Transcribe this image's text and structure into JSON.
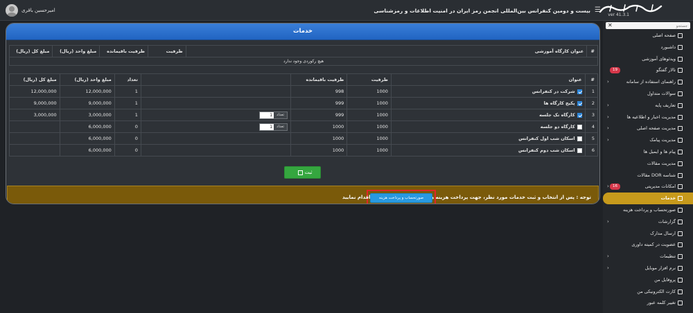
{
  "header": {
    "logo_alt": "تریبون",
    "version": "ver 41.3.1",
    "title": "بیست و دومین کنفرانس بین‌المللی انجمن رمز ایران در امنیت اطلاعات و رمزشناسی",
    "user_name": "امیرحسین باقری"
  },
  "sidebar": {
    "search_placeholder": "جستجو",
    "items": [
      {
        "label": "صفحه اصلی",
        "icon": "home-icon",
        "chevron": false
      },
      {
        "label": "داشبورد",
        "icon": "dashboard-icon",
        "chevron": false
      },
      {
        "label": "ویدئوهای آموزشی",
        "icon": "video-icon",
        "chevron": false
      },
      {
        "label": "تالار گفتگو",
        "icon": "chat-icon",
        "chevron": false,
        "badge": "19"
      },
      {
        "label": "راهنمای استفاده از سامانه",
        "icon": "info-icon",
        "chevron": true
      },
      {
        "label": "سوالات متداول",
        "icon": "faq-icon",
        "chevron": false
      },
      {
        "label": "تعاریف پایه",
        "icon": "list-icon",
        "chevron": true
      },
      {
        "label": "مدیریت اخبار و اطلاعیه ها",
        "icon": "news-icon",
        "chevron": true
      },
      {
        "label": "مدیریت صفحه اصلی",
        "icon": "home-settings-icon",
        "chevron": true
      },
      {
        "label": "مدیریت پیامک",
        "icon": "sms-icon",
        "chevron": true
      },
      {
        "label": "پیام ها و ایمیل ها",
        "icon": "mail-icon",
        "chevron": false
      },
      {
        "label": "مدیریت مقالات",
        "icon": "articles-icon",
        "chevron": false
      },
      {
        "label": "شناسه DOR مقالات",
        "icon": "dor-icon",
        "chevron": false
      },
      {
        "label": "امکانات مدیریتی",
        "icon": "tools-icon",
        "chevron": true,
        "badge": "16"
      },
      {
        "label": "خدمات",
        "icon": "services-icon",
        "chevron": false,
        "active": true
      },
      {
        "label": "صورتحساب و پرداخت هزینه",
        "icon": "invoice-icon",
        "chevron": false
      },
      {
        "label": "گزارشات",
        "icon": "reports-icon",
        "chevron": true
      },
      {
        "label": "ارسال مدارک",
        "icon": "upload-icon",
        "chevron": false
      },
      {
        "label": "عضویت در کمیته داوری",
        "icon": "committee-icon",
        "chevron": false
      },
      {
        "label": "تنظیمات",
        "icon": "settings-icon",
        "chevron": true
      },
      {
        "label": "نرم افزار موبایل",
        "icon": "mobile-icon",
        "chevron": true
      },
      {
        "label": "پروفایل من",
        "icon": "profile-icon",
        "chevron": false
      },
      {
        "label": "کارت الکترونیکی من",
        "icon": "card-icon",
        "chevron": false
      },
      {
        "label": "تغییر کلمه عبور",
        "icon": "key-icon",
        "chevron": false
      }
    ]
  },
  "main": {
    "title": "خدمات",
    "workshop_table": {
      "headers": [
        "#",
        "عنوان کارگاه آموزشی",
        "ظرفیت",
        "ظرفیت باقیمانده",
        "مبلغ واحد (ریال)",
        "مبلغ کل (ریال)"
      ],
      "empty_text": "هیچ رکوردی وجود ندارد"
    },
    "services_table": {
      "headers": [
        "#",
        "عنوان",
        "ظرفیت",
        "ظرفیت باقیمانده",
        "",
        "تعداد",
        "مبلغ واحد (ریال)",
        "مبلغ کل (ریال)"
      ],
      "qty_label": "تعداد",
      "rows": [
        {
          "num": "1",
          "title": "شرکت در کنفرانس",
          "checked": true,
          "capacity": "1000",
          "remaining": "998",
          "qty_input": null,
          "count": "1",
          "unit_price": "12,000,000",
          "total": "12,000,000"
        },
        {
          "num": "2",
          "title": "پکیج کارگاه ها",
          "checked": true,
          "capacity": "1000",
          "remaining": "999",
          "qty_input": null,
          "count": "1",
          "unit_price": "9,000,000",
          "total": "9,000,000"
        },
        {
          "num": "3",
          "title": "کارگاه تک جلسه",
          "checked": true,
          "capacity": "1000",
          "remaining": "999",
          "qty_input": "1",
          "count": "1",
          "unit_price": "3,000,000",
          "total": "3,000,000"
        },
        {
          "num": "4",
          "title": "کارگاه دو جلسه",
          "checked": false,
          "capacity": "1000",
          "remaining": "1000",
          "qty_input": "1",
          "count": "0",
          "unit_price": "6,000,000",
          "total": ""
        },
        {
          "num": "5",
          "title": "اسکان شب اول کنفرانس",
          "checked": false,
          "capacity": "1000",
          "remaining": "1000",
          "qty_input": null,
          "count": "0",
          "unit_price": "6,000,000",
          "total": ""
        },
        {
          "num": "6",
          "title": "اسکان شب دوم کنفرانس",
          "checked": false,
          "capacity": "1000",
          "remaining": "1000",
          "qty_input": null,
          "count": "0",
          "unit_price": "6,000,000",
          "total": ""
        }
      ]
    },
    "save_label": "ثبت",
    "notice": {
      "text_before": "توجه : پس از انتخاب و ثبت خدمات مورد نظر، جهت پرداخت هزینه ها از قسمت",
      "button_label": "صورتحساب و پرداخت هزینه",
      "text_after": "اقدام نمایید"
    }
  },
  "colors": {
    "header_blue": "#2164c2",
    "active_menu": "#c79a1c",
    "notice_bg": "#7a5a0a",
    "save_green": "#35a63f",
    "pay_blue": "#2899e0",
    "highlight_red": "#e32626",
    "badge_red": "#d6374a"
  }
}
